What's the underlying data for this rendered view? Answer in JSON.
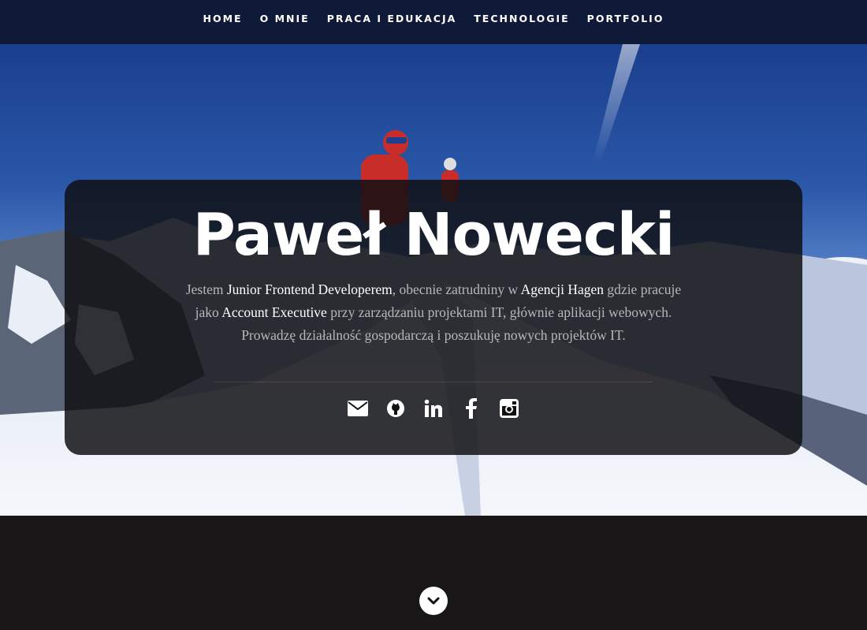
{
  "nav": {
    "items": [
      {
        "label": "HOME"
      },
      {
        "label": "O MNIE"
      },
      {
        "label": "PRACA I EDUKACJA"
      },
      {
        "label": "TECHNOLOGIE"
      },
      {
        "label": "PORTFOLIO"
      }
    ]
  },
  "hero": {
    "name": "Paweł Nowecki",
    "intro": {
      "t1": "Jestem ",
      "b1": "Junior Frontend Developerem",
      "t2": ", obecnie zatrudniny w ",
      "b2": "Agencji Hagen",
      "t3": " gdzie pracuje jako ",
      "b3": "Account Executive",
      "t4": " przy zarządzaniu projektami IT, głównie aplikacji webowych.",
      "line2": "Prowadzę działalność gospodarczą i poszukuję nowych projektów IT."
    },
    "socials": [
      {
        "icon": "envelope-icon"
      },
      {
        "icon": "github-icon"
      },
      {
        "icon": "linkedin-icon"
      },
      {
        "icon": "facebook-icon"
      },
      {
        "icon": "instagram-icon"
      }
    ]
  },
  "scroll": {
    "icon": "chevron-down-icon"
  },
  "colors": {
    "navbar_bg": "#0f1a38",
    "card_bg": "rgba(14,14,18,0.84)",
    "page_bg": "#181617",
    "text_highlight": "#ffffff",
    "text_muted": "#b8b8b8"
  }
}
